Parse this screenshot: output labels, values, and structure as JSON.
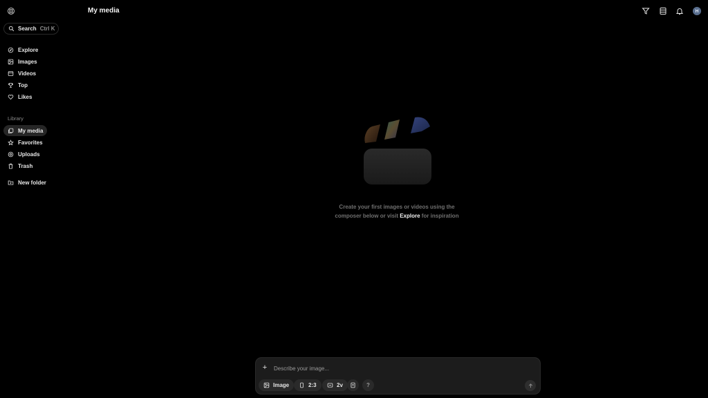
{
  "sidebar": {
    "search": {
      "label": "Search",
      "shortcut": "Ctrl K"
    },
    "nav": [
      {
        "label": "Explore",
        "icon": "compass-icon"
      },
      {
        "label": "Images",
        "icon": "image-icon"
      },
      {
        "label": "Videos",
        "icon": "video-icon"
      },
      {
        "label": "Top",
        "icon": "trophy-icon"
      },
      {
        "label": "Likes",
        "icon": "heart-icon"
      }
    ],
    "library_label": "Library",
    "library": [
      {
        "label": "My media",
        "icon": "media-icon",
        "active": true
      },
      {
        "label": "Favorites",
        "icon": "star-icon"
      },
      {
        "label": "Uploads",
        "icon": "upload-icon"
      },
      {
        "label": "Trash",
        "icon": "trash-icon"
      }
    ],
    "new_folder": {
      "label": "New folder",
      "icon": "folder-plus-icon"
    }
  },
  "header": {
    "title": "My media",
    "avatar_initial": "H",
    "icons": [
      "filter-icon",
      "layers-icon",
      "bell-icon"
    ]
  },
  "empty_state": {
    "line1": "Create your first images or videos using the",
    "line2_before": "composer below or visit",
    "link": "Explore",
    "line2_after": "for inspiration"
  },
  "composer": {
    "placeholder": "Describe your image...",
    "mode": "Image",
    "aspect": "2:3",
    "variants": "2v",
    "help": "?"
  },
  "colors": {
    "background": "#000000",
    "accent_avatar": "#5a6f8f",
    "surface": "#1c1c1c"
  }
}
